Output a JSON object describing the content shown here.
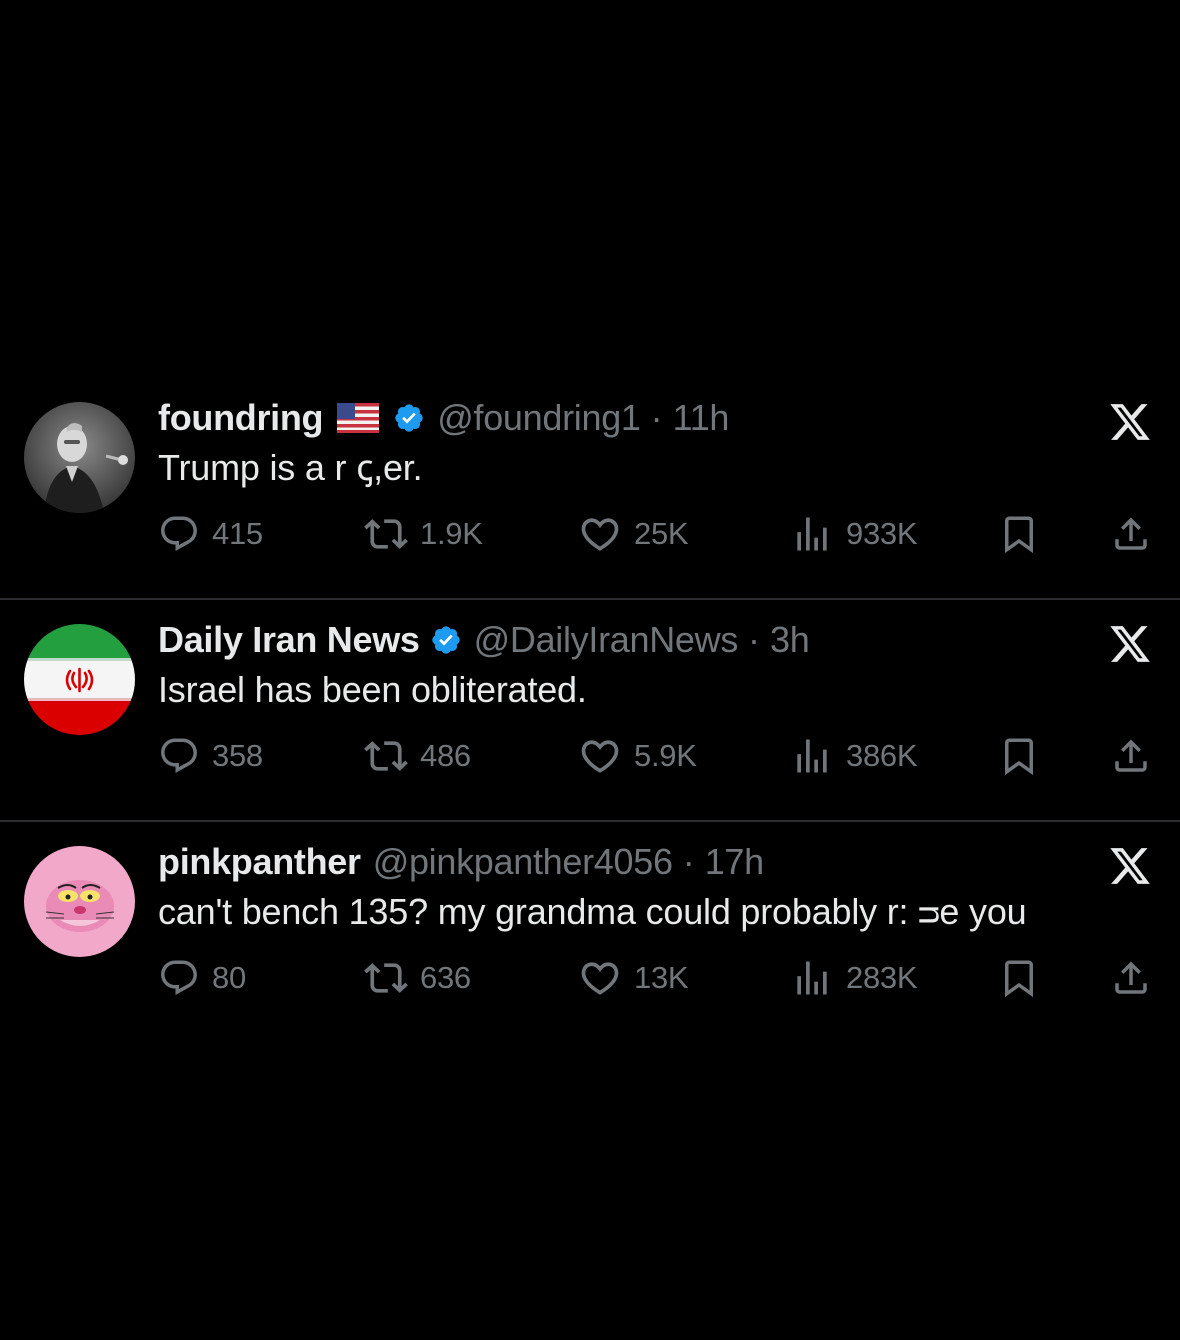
{
  "tweets": [
    {
      "name": "foundring",
      "has_flag": true,
      "verified": true,
      "handle": "@foundring1",
      "time": "11h",
      "text": "Trump is a r  ꞔ,er.",
      "replies": "415",
      "reposts": "1.9K",
      "likes": "25K",
      "views": "933K",
      "avatar_icon": "person-grayscale-avatar"
    },
    {
      "name": "Daily Iran News",
      "has_flag": false,
      "verified": true,
      "handle": "@DailyIranNews",
      "time": "3h",
      "text": "Israel has been obliterated.",
      "replies": "358",
      "reposts": "486",
      "likes": "5.9K",
      "views": "386K",
      "avatar_icon": "iran-flag-avatar"
    },
    {
      "name": "pinkpanther",
      "has_flag": false,
      "verified": false,
      "handle": "@pinkpanther4056",
      "time": "17h",
      "text": "can't bench 135? my grandma could probably r:  ᴝe you",
      "replies": "80",
      "reposts": "636",
      "likes": "13K",
      "views": "283K",
      "avatar_icon": "pink-panther-avatar"
    }
  ],
  "separator": "·",
  "colors": {
    "background": "#000000",
    "primary_text": "#e7e9ea",
    "secondary_text": "#71767b",
    "verified_blue": "#1d9bf0",
    "divider": "#2b2d30"
  }
}
